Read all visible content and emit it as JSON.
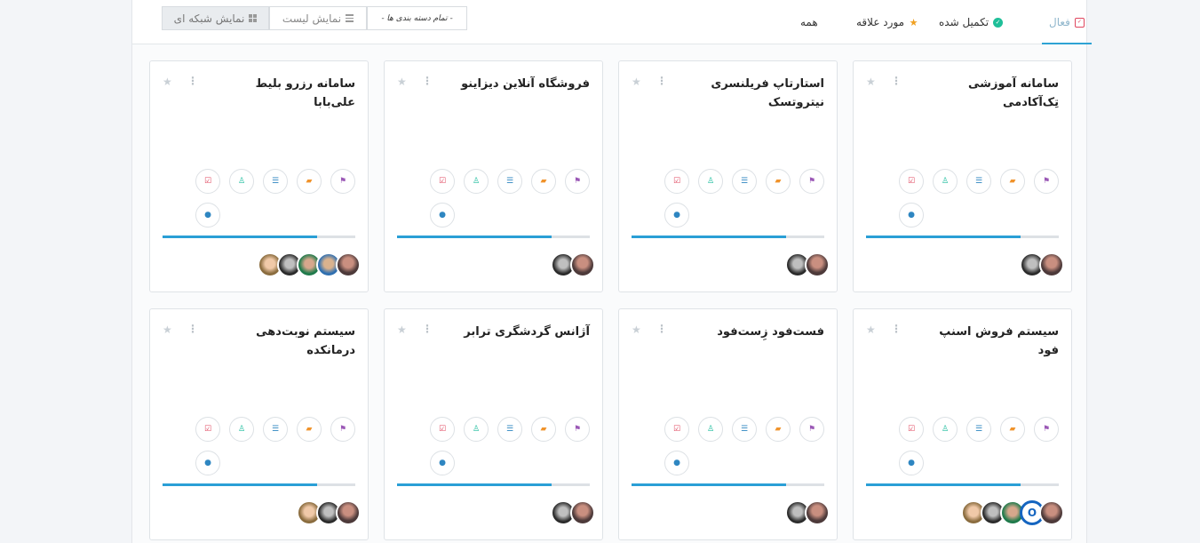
{
  "filters": {
    "active": "فعال",
    "completed": "تکمیل شده",
    "favorite": "مورد علاقه",
    "all": "همه"
  },
  "views": {
    "grid_label": "نمایش شبکه ای",
    "list_label": "نمایش لیست",
    "sort_label": "- تمام دسته بندی ها -"
  },
  "icons": {
    "star": "star-icon",
    "menu": "kebab-menu-icon",
    "actions": [
      "flag-icon",
      "folder-icon",
      "list-icon",
      "user-icon",
      "check-square-icon",
      "chat-icon"
    ]
  },
  "colors": {
    "accent": "#2a9fd6",
    "active_tab": "#e0465e",
    "done": "#1fbf99",
    "favorite": "#f0a020"
  },
  "projects": [
    {
      "title": "سامانه آموزشی تِک‌آکادمی",
      "progress": 0.8,
      "members": 2
    },
    {
      "title": "استارتاپ فریلنسری نیتروتسک",
      "progress": 0.8,
      "members": 2
    },
    {
      "title": "فروشگاه آنلاین دیزاینو",
      "progress": 0.8,
      "members": 2
    },
    {
      "title": "سامانه رزرو بلیط علی‌بابا",
      "progress": 0.8,
      "members": 5
    },
    {
      "title": "سیستم فروش اسنپ فود",
      "progress": 0.8,
      "members": 5
    },
    {
      "title": "فست‌فود زِست‌فود",
      "progress": 0.8,
      "members": 2
    },
    {
      "title": "آژانس گردشگری ترابر",
      "progress": 0.8,
      "members": 2
    },
    {
      "title": "سیستم نوبت‌دهی درمانکده",
      "progress": 0.8,
      "members": 3
    }
  ]
}
